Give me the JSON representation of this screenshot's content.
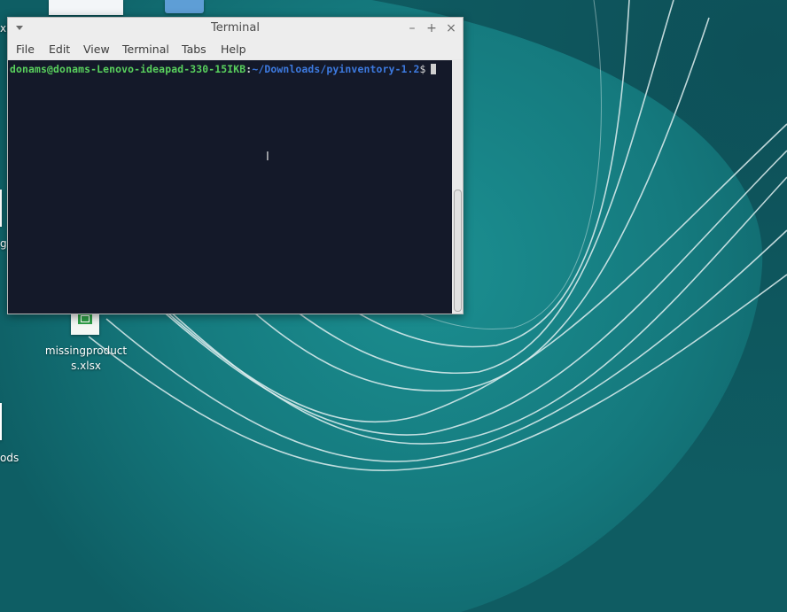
{
  "desktop": {
    "icons": [
      {
        "label_line1": "missingproduct",
        "label_line2": "s.xlsx"
      },
      {
        "label_line1": "xl"
      },
      {
        "label_line1": "g"
      },
      {
        "label_line1": "ods"
      }
    ]
  },
  "terminal": {
    "title": "Terminal",
    "menu": [
      "File",
      "Edit",
      "View",
      "Terminal",
      "Tabs",
      "Help"
    ],
    "prompt": {
      "user_host": "donams@donams-Lenovo-ideapad-330-15IKB",
      "separator": ":",
      "path": "~/Downloads/pyinventory-1.2",
      "symbol": "$"
    },
    "controls": {
      "minimize": "–",
      "maximize": "+",
      "close": "×"
    }
  },
  "colors": {
    "desktop_bg": "#0f5a60",
    "terminal_bg": "#141929",
    "prompt_user": "#59d15d",
    "prompt_path": "#3d7ae0",
    "titlebar": "#ededed"
  }
}
